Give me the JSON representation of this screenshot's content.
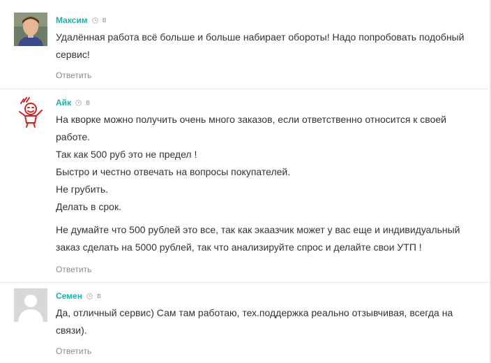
{
  "comments": [
    {
      "author": "Максим",
      "date": "в",
      "paragraphs": [
        "Удалённая работа всё больше и больше набирает обороты! Надо попробовать подобный сервис!"
      ],
      "reply": "Ответить"
    },
    {
      "author": "Айк",
      "date": "в",
      "paragraphs": [
        "На кворке можно получить очень много заказов, если ответственно относится к своей работе.",
        "Так как 500 руб это не предел !",
        "Быстро и честно отвечать на вопросы покупателей.",
        "Не грубить.",
        "Делать в срок.",
        "Не думайте что 500 рублей это все, так как экаазчик может у вас еще и индивидуальный заказ сделать на 5000 рублей, так что анализируйте спрос и делайте свои УТП !"
      ],
      "reply": "Ответить"
    },
    {
      "author": "Семен",
      "date": "в",
      "paragraphs": [
        "Да, отличный сервис) Сам там работаю, тех.поддержка реально отзывчивая, всегда на связи)."
      ],
      "reply": "Ответить"
    }
  ],
  "colors": {
    "author": "#1fb0a3",
    "text": "#333333",
    "reply": "#8a8a8a"
  }
}
